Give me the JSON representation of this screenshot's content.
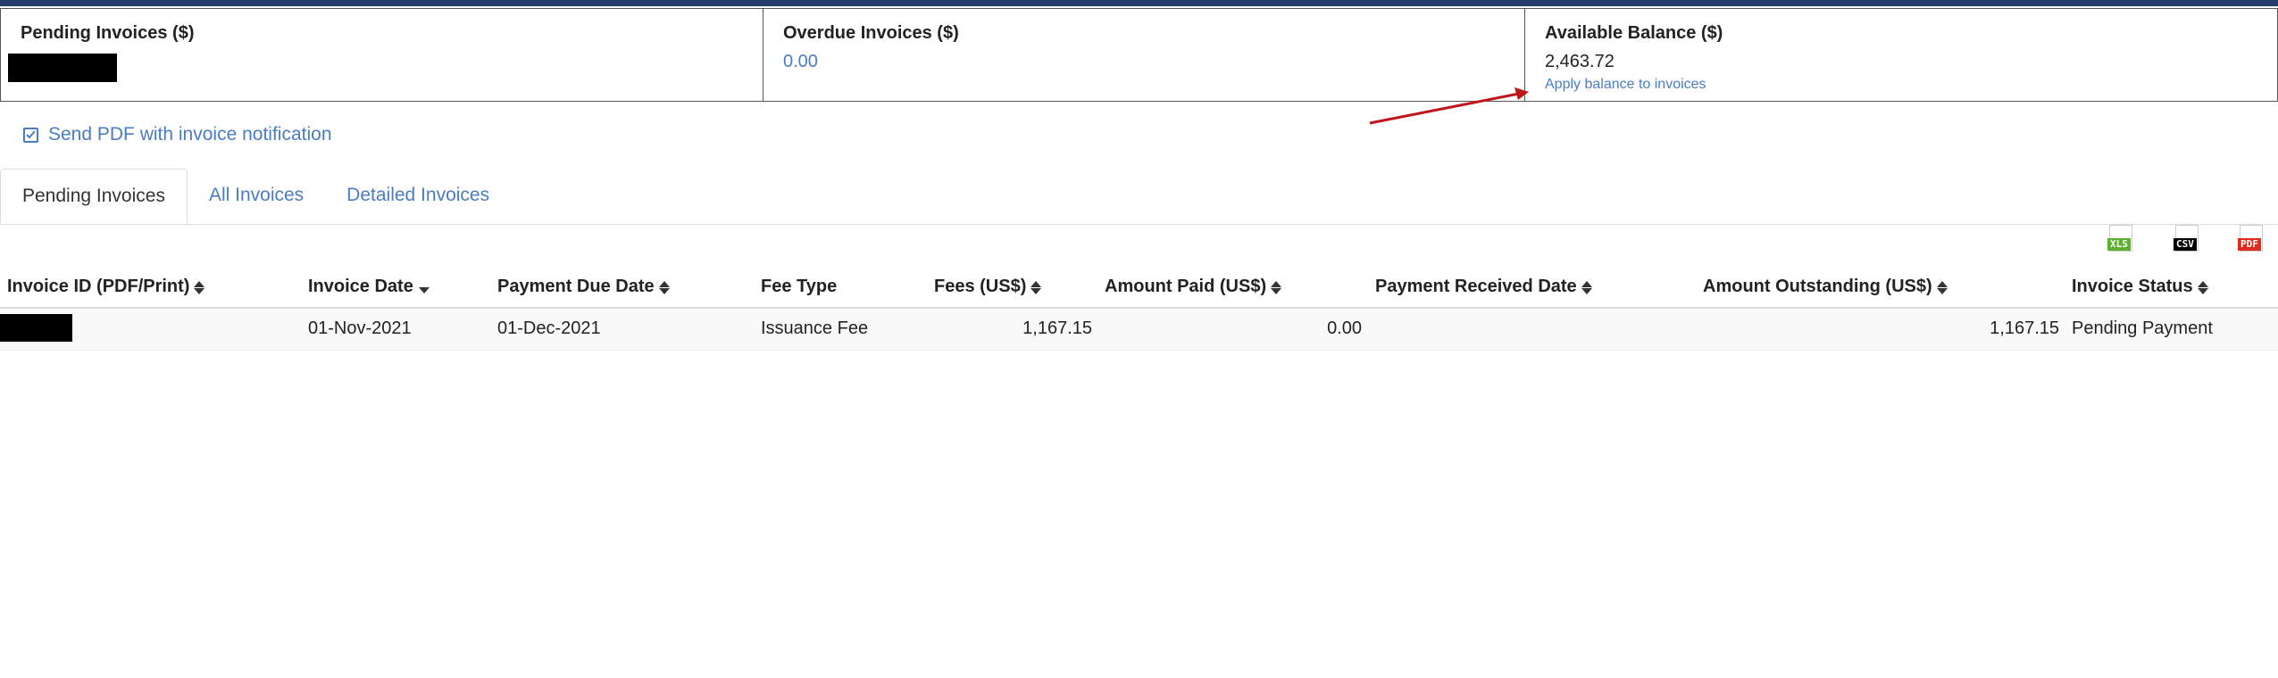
{
  "summary": {
    "pending": {
      "title": "Pending Invoices ($)"
    },
    "overdue": {
      "title": "Overdue Invoices ($)",
      "value": "0.00"
    },
    "balance": {
      "title": "Available Balance ($)",
      "value": "2,463.72",
      "link": "Apply balance to invoices"
    }
  },
  "options": {
    "send_pdf_label": "Send PDF with invoice notification",
    "send_pdf_checked": true
  },
  "tabs": [
    {
      "label": "Pending Invoices",
      "active": true
    },
    {
      "label": "All Invoices",
      "active": false
    },
    {
      "label": "Detailed Invoices",
      "active": false
    }
  ],
  "exports": {
    "xls": "XLS",
    "csv": "CSV",
    "pdf": "PDF"
  },
  "table": {
    "columns": [
      "Invoice ID (PDF/Print)",
      "Invoice Date",
      "Payment Due Date",
      "Fee Type",
      "Fees (US$)",
      "Amount Paid (US$)",
      "Payment Received Date",
      "Amount Outstanding (US$)",
      "Invoice Status"
    ],
    "rows": [
      {
        "invoice_date": "01-Nov-2021",
        "due_date": "01-Dec-2021",
        "fee_type": "Issuance Fee",
        "fees": "1,167.15",
        "amount_paid": "0.00",
        "payment_received_date": "",
        "amount_outstanding": "1,167.15",
        "status": "Pending Payment"
      }
    ]
  },
  "colors": {
    "accent": "#4a7cc4",
    "topbar": "#253d6e",
    "arrow": "#c0151a",
    "xls": "#5cb030",
    "csv": "#000000",
    "pdf": "#e0291f"
  }
}
